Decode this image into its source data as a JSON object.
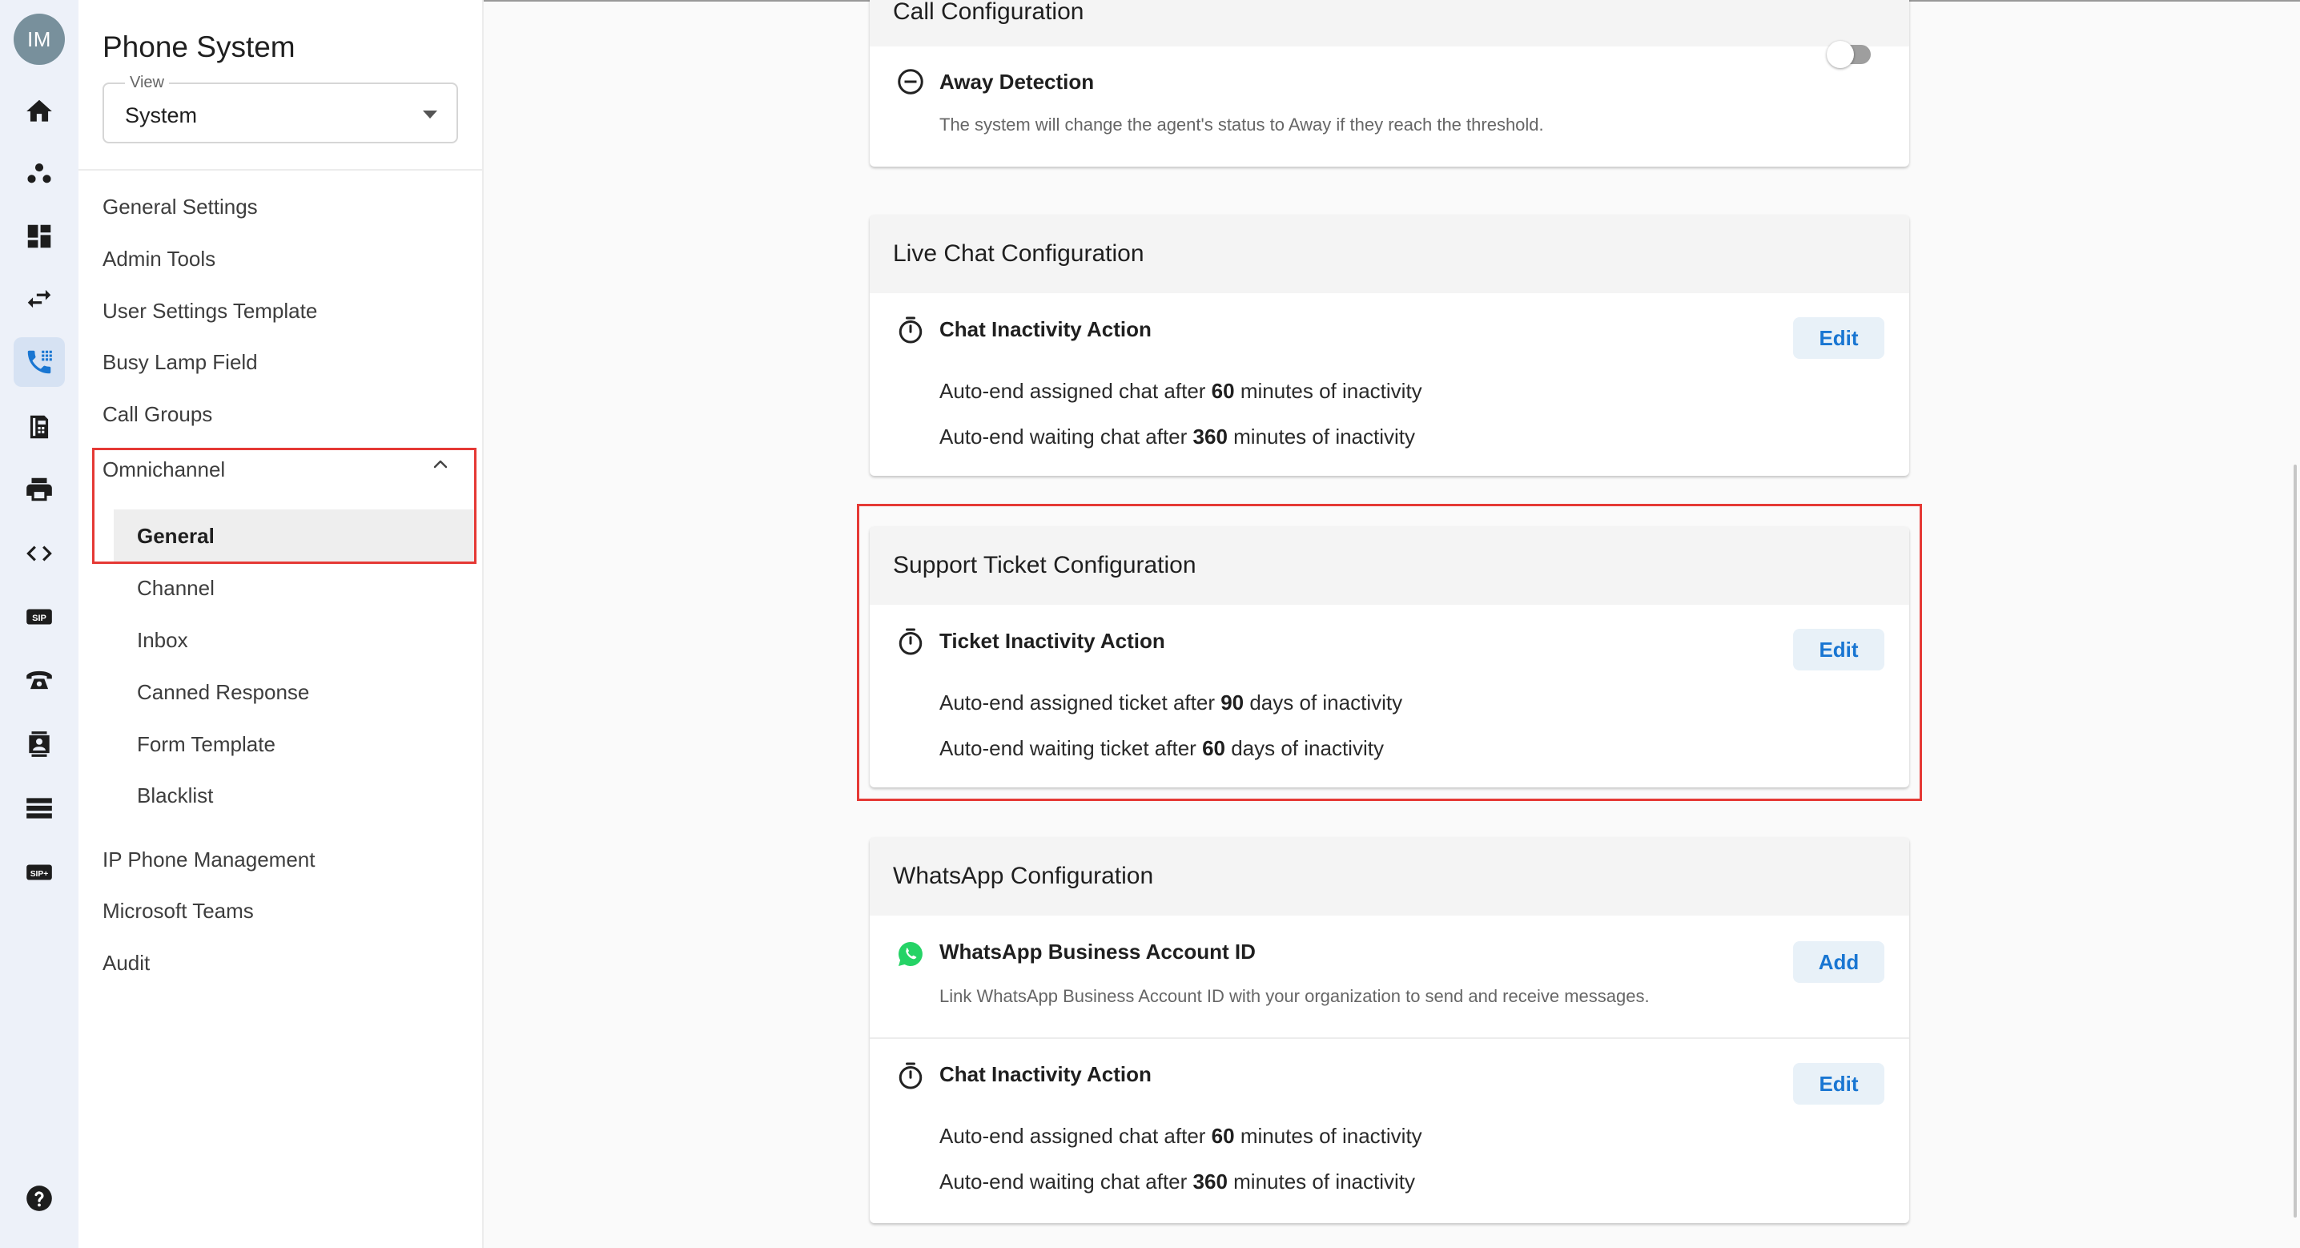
{
  "user": {
    "initials": "IM"
  },
  "rail": {
    "items": [
      {
        "icon": "home-icon"
      },
      {
        "icon": "group-icon"
      },
      {
        "icon": "dashboard-icon"
      },
      {
        "icon": "transfer-arrows-icon"
      },
      {
        "icon": "phone-system-icon",
        "active": true
      },
      {
        "icon": "fax-machine-icon"
      },
      {
        "icon": "printer-icon"
      },
      {
        "icon": "code-icon"
      },
      {
        "icon": "sip-icon",
        "text": "SIP"
      },
      {
        "icon": "desk-phone-icon"
      },
      {
        "icon": "contact-card-icon"
      },
      {
        "icon": "storage-list-icon"
      },
      {
        "icon": "sip-plus-icon",
        "text": "SIP+"
      },
      {
        "icon": "help-icon"
      }
    ]
  },
  "sidebar": {
    "title": "Phone System",
    "view": {
      "label": "View",
      "value": "System"
    },
    "items": [
      "General Settings",
      "Admin Tools",
      "User Settings Template",
      "Busy Lamp Field",
      "Call Groups"
    ],
    "omnichannel": {
      "label": "Omnichannel",
      "children": [
        "General",
        "Channel",
        "Inbox",
        "Canned Response",
        "Form Template",
        "Blacklist"
      ]
    },
    "items_after": [
      "IP Phone Management",
      "Microsoft Teams",
      "Audit"
    ]
  },
  "main": {
    "call_config": {
      "title": "Call Configuration",
      "away": {
        "title": "Away Detection",
        "desc": "The system will change the agent's status to Away if they reach the threshold.",
        "enabled": false
      }
    },
    "live_chat": {
      "title": "Live Chat Configuration",
      "row": {
        "title": "Chat Inactivity Action",
        "button": "Edit",
        "line1": {
          "pre": "Auto-end assigned chat after ",
          "val": "60",
          "post": " minutes of inactivity"
        },
        "line2": {
          "pre": "Auto-end waiting chat after ",
          "val": "360",
          "post": " minutes of inactivity"
        }
      }
    },
    "support_ticket": {
      "title": "Support Ticket Configuration",
      "row": {
        "title": "Ticket Inactivity Action",
        "button": "Edit",
        "line1": {
          "pre": "Auto-end assigned ticket after ",
          "val": "90",
          "post": " days of inactivity"
        },
        "line2": {
          "pre": "Auto-end waiting ticket after ",
          "val": "60",
          "post": " days of inactivity"
        }
      }
    },
    "whatsapp": {
      "title": "WhatsApp Configuration",
      "account": {
        "title": "WhatsApp Business Account ID",
        "desc": "Link WhatsApp Business Account ID with your organization to send and receive messages.",
        "button": "Add"
      },
      "row": {
        "title": "Chat Inactivity Action",
        "button": "Edit",
        "line1": {
          "pre": "Auto-end assigned chat after ",
          "val": "60",
          "post": " minutes of inactivity"
        },
        "line2": {
          "pre": "Auto-end waiting chat after ",
          "val": "360",
          "post": " minutes of inactivity"
        }
      }
    }
  },
  "colors": {
    "accent": "#1976d2",
    "highlight": "#e53935",
    "whatsapp": "#25d366",
    "rail_bg": "#edf1f9"
  }
}
